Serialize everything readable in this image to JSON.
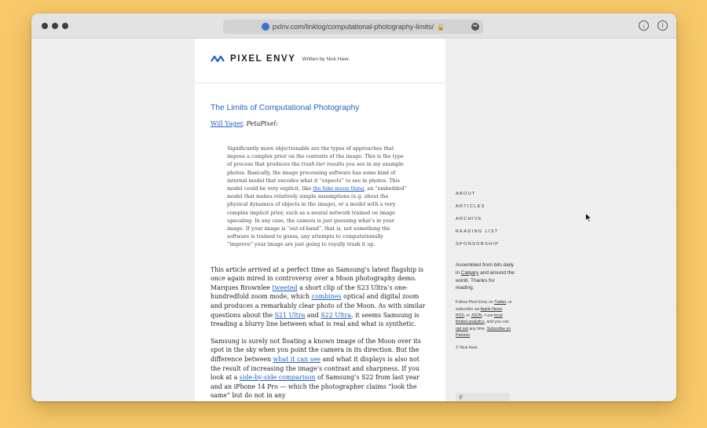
{
  "browser": {
    "url": "pxlnv.com/linklog/computational-photography-limits/",
    "lock_icon": "lock-icon",
    "more_icon": "ellipsis-icon",
    "download_icon": "download-icon",
    "info_icon": "info-icon"
  },
  "site": {
    "brand": "PIXEL ENVY",
    "byline": "Written by Nick Heer.",
    "accent": "#1f5fc5"
  },
  "post": {
    "title": "The Limits of Computational Photography",
    "author_link": "Will Yager",
    "source": "PetaPixel",
    "quote": [
      "Significantly more objectionable are the types of approaches that impose a complex prior on the contents of the image. This is the type of process that produces the ",
      "trash-tier",
      " results you see in my example photos. Basically, the image processing software has some kind of internal model that encodes what it “expects” to see in photos. This model could be very explicit, like ",
      "the fake moon thing",
      ", an “embedded” model that makes relatively simple assumptions (e.g. about the physical dynamics of objects in the image), or a model with a very complex implicit prior, such as a neural network trained on image upscaling. In any case, the camera is just guessing what’s in your image. If your image is “out-of-band”, that is, not something the software is trained to guess, any attempts to computationally “improve” your image are just going to royally trash it up."
    ],
    "p1": [
      "This article arrived at a perfect time as Samsung’s latest flagship is once again mired in controversy over a Moon photography demo. Marques Brownlee ",
      "tweeted",
      " a short clip of the S23 Ultra’s one-hundredfold zoom mode, which ",
      "combines",
      " optical and digital zoom and produces a remarkably clear photo of the Moon. As with similar questions about the ",
      "S21 Ultra",
      " and ",
      "S22 Ultra",
      ", it seems Samsung is treading a blurry line between what is real and what is synthetic."
    ],
    "p2": [
      "Samsung is surely not floating a known image of the Moon over its spot in the sky when you point the camera in its direction. But the difference between ",
      "what it can see",
      " and what it displays is also not the result of increasing the image’s contrast and sharpness. If you look at a ",
      "side-by-side comparison",
      " of Samsung’s S22 from last year and an iPhone 14 Pro — which the photographer claims “look the same” but do not in any"
    ]
  },
  "sidebar": {
    "nav": [
      "ABOUT",
      "ARTICLES",
      "ARCHIVE",
      "READING LIST",
      "SPONSORSHIP"
    ],
    "blurb": [
      "Assembled from bits daily in ",
      "Calgary",
      " and around the world. Thanks for reading."
    ],
    "note": [
      "Follow Pixel Envy on ",
      "Twitter",
      ", or subscribe via ",
      "Apple News",
      ", ",
      "RSS",
      ", or ",
      "JSON",
      ". I use ",
      "local limited analytics",
      ", and you can ",
      "opt out",
      " any time. ",
      "Subscribe on Patreon",
      "."
    ],
    "copyright": "© Nick Heer.",
    "search_icon": "search-icon"
  }
}
